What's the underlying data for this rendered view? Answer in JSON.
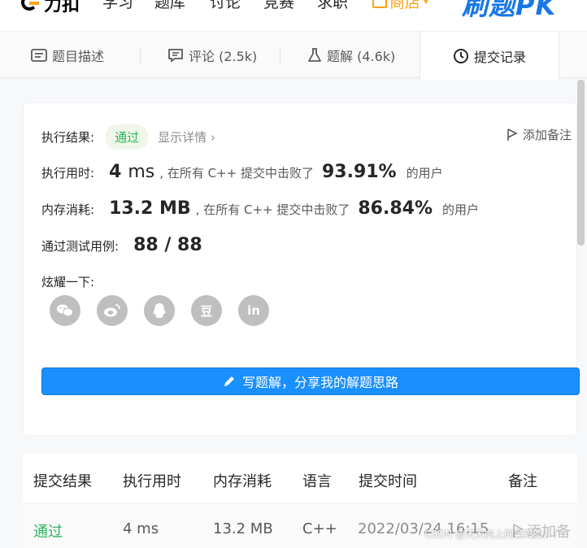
{
  "nav": {
    "logo_text": "力扣",
    "items": [
      "学习",
      "题库",
      "讨论",
      "竞赛",
      "求职"
    ],
    "store_label": "商店",
    "pk_label": "刷题PK"
  },
  "tabs": [
    {
      "label": "题目描述",
      "icon": "description-icon"
    },
    {
      "label": "评论 (2.5k)",
      "icon": "comment-icon"
    },
    {
      "label": "题解 (4.6k)",
      "icon": "flask-icon"
    },
    {
      "label": "提交记录",
      "icon": "clock-icon"
    }
  ],
  "result": {
    "status_label": "执行结果:",
    "status_value": "通过",
    "details_link": "显示详情 ›",
    "add_note": "添加备注",
    "runtime_label": "执行用时:",
    "runtime_value": "4",
    "runtime_unit": "ms",
    "runtime_text": ", 在所有 C++ 提交中击败了",
    "runtime_pct": "93.91%",
    "runtime_suffix": "的用户",
    "memory_label": "内存消耗:",
    "memory_value": "13.2 MB",
    "memory_text": ", 在所有 C++ 提交中击败了",
    "memory_pct": "86.84%",
    "memory_suffix": "的用户",
    "cases_label": "通过测试用例:",
    "cases_value": "88 / 88",
    "share_label": "炫耀一下:",
    "share_icons": [
      "wechat-icon",
      "weibo-icon",
      "qq-icon",
      "douban-icon",
      "linkedin-icon"
    ],
    "douban_glyph": "豆",
    "linkedin_glyph": "in",
    "solution_button": "写题解，分享我的解题思路"
  },
  "table": {
    "headers": [
      "提交结果",
      "执行用时",
      "内存消耗",
      "语言",
      "提交时间",
      "备注"
    ],
    "rows": [
      {
        "result": "通过",
        "runtime": "4 ms",
        "memory": "13.2 MB",
        "language": "C++",
        "time": "2022/03/24 16:15",
        "note": "添加备"
      }
    ]
  },
  "watermark": "CSDN @天天向上的菜鸡杰！！",
  "colors": {
    "accent": "#ffa116",
    "success": "#2db55d",
    "primary": "#1a90ff"
  }
}
